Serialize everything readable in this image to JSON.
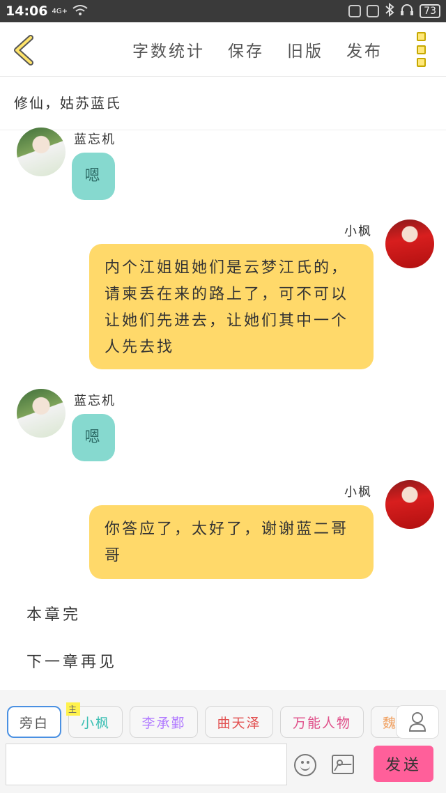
{
  "status_bar": {
    "time": "14:06",
    "network": "4G+",
    "battery": "73"
  },
  "header": {
    "menu": [
      "字数统计",
      "保存",
      "旧版",
      "发布"
    ]
  },
  "chapter_title": "修仙，姑苏蓝氏",
  "messages": [
    {
      "side": "left",
      "name": "蓝忘机",
      "text": "嗯"
    },
    {
      "side": "right",
      "name": "小枫",
      "text": "内个江姐姐她们是云梦江氏的，请柬丢在来的路上了，可不可以让她们先进去，让她们其中一个人先去找"
    },
    {
      "side": "left",
      "name": "蓝忘机",
      "text": "嗯"
    },
    {
      "side": "right",
      "name": "小枫",
      "text": "你答应了，太好了，谢谢蓝二哥哥"
    }
  ],
  "plain_text": [
    "本章完",
    "下一章再见"
  ],
  "roles": {
    "narration": "旁白",
    "main_tag": "主",
    "items": [
      {
        "label": "小枫",
        "color": "#3bbfb3"
      },
      {
        "label": "李承鄞",
        "color": "#b27cff"
      },
      {
        "label": "曲天泽",
        "color": "#e25050"
      },
      {
        "label": "万能人物",
        "color": "#e0508a"
      },
      {
        "label": "魏",
        "color": "#f0a060"
      }
    ]
  },
  "composer": {
    "input_value": "",
    "send_label": "发送"
  },
  "colors": {
    "accent_yellow": "#ffd96a",
    "accent_teal": "#86d9cf",
    "send_pink": "#ff5f9a"
  }
}
